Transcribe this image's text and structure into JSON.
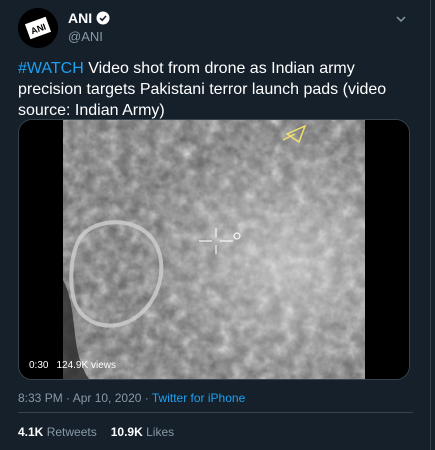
{
  "tweet": {
    "author": {
      "name": "ANI",
      "handle": "@ANI"
    },
    "hashtag": "#WATCH",
    "body": " Video shot from drone as Indian army precision targets Pakistani terror launch pads (video source: Indian Army)",
    "video": {
      "time": "0:30",
      "views": "124.9K views"
    },
    "timestamp": "8:33 PM · Apr 10, 2020",
    "separator": " · ",
    "source": "Twitter for iPhone",
    "retweets": {
      "count": "4.1K",
      "label": "Retweets"
    },
    "likes": {
      "count": "10.9K",
      "label": "Likes"
    }
  },
  "colors": {
    "background": "#15202b",
    "accent": "#1da1f2",
    "secondary_text": "#8899a6",
    "border": "#38444d"
  },
  "icons": {
    "verified": "verified-badge-icon",
    "menu": "chevron-down-icon",
    "crosshair": "crosshair-icon"
  }
}
